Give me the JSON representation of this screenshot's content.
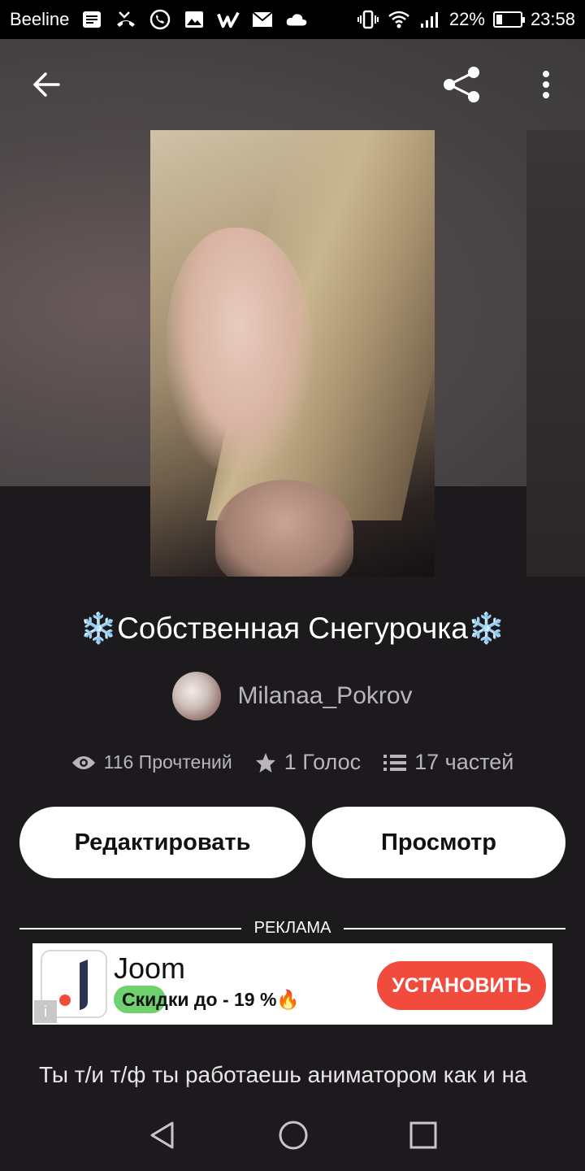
{
  "status_bar": {
    "carrier": "Beeline",
    "battery": "22%",
    "time": "23:58"
  },
  "story": {
    "title": "❄️Собственная Снегурочка❄️",
    "author": "Milanaa_Pokrov",
    "reads": "116 Прочтений",
    "votes": "1 Голос",
    "parts": "17 частей",
    "edit_label": "Редактировать",
    "view_label": "Просмотр",
    "description": "Ты т/и т/ф ты работаешь аниматором как и на детских праздниках, и на корпоративах ты"
  },
  "ad": {
    "label": "РЕКЛАМА",
    "title": "Joom",
    "subtitle": "Скидки до - 19 %🔥",
    "install_label": "УСТАНОВИТЬ"
  },
  "colors": {
    "background": "#1c1a1d",
    "install_button": "#f04b3c",
    "discount_pill": "#6fd26f"
  }
}
